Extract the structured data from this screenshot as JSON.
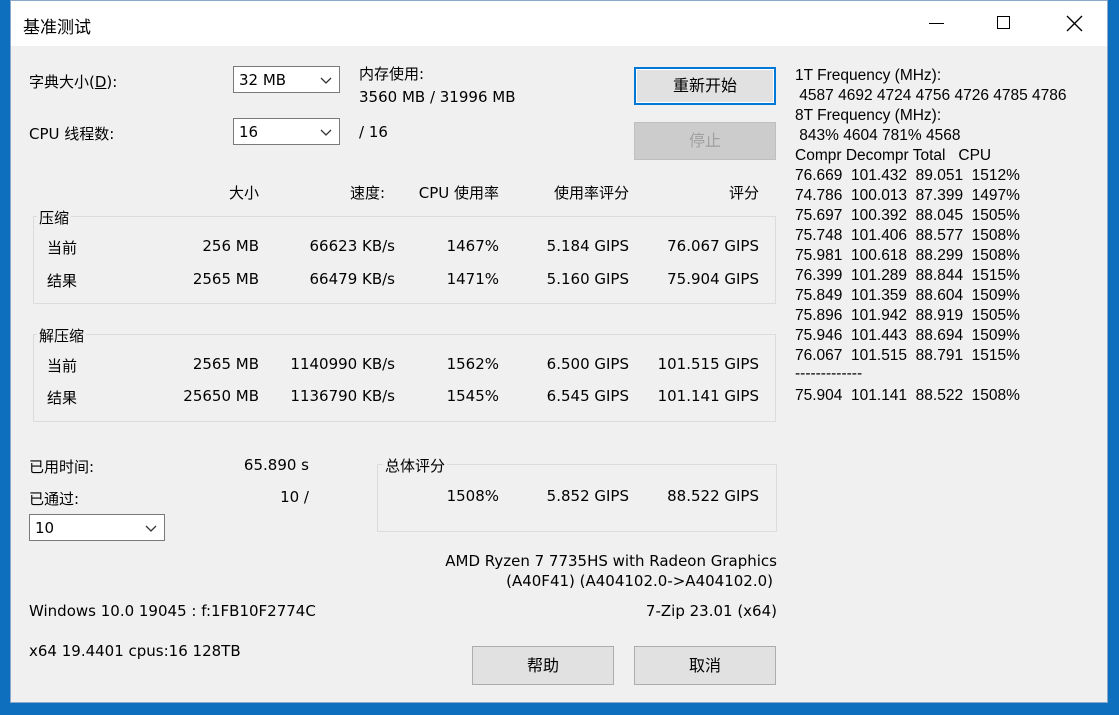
{
  "window": {
    "title": "基准测试",
    "controls": {
      "minimize": "minimize",
      "maximize": "maximize",
      "close": "close"
    }
  },
  "settings": {
    "dict_label_pre": "字典大小(",
    "dict_label_key": "D",
    "dict_label_post": "):",
    "dict_value": "32 MB",
    "threads_label": "CPU 线程数:",
    "threads_value": "16",
    "threads_total": "/ 16",
    "memory_label": "内存使用:",
    "memory_value": "3560 MB / 31996 MB"
  },
  "buttons": {
    "restart": "重新开始",
    "stop": "停止",
    "help": "帮助",
    "cancel": "取消"
  },
  "table": {
    "headers": {
      "size": "大小",
      "speed": "速度:",
      "cpu": "CPU 使用率",
      "rating_usage": "使用率评分",
      "rating": "评分"
    },
    "compress": {
      "label": "压缩",
      "rows": [
        {
          "name": "当前",
          "size": "256 MB",
          "speed": "66623 KB/s",
          "cpu": "1467%",
          "rating_usage": "5.184 GIPS",
          "rating": "76.067 GIPS"
        },
        {
          "name": "结果",
          "size": "2565 MB",
          "speed": "66479 KB/s",
          "cpu": "1471%",
          "rating_usage": "5.160 GIPS",
          "rating": "75.904 GIPS"
        }
      ]
    },
    "decompress": {
      "label": "解压缩",
      "rows": [
        {
          "name": "当前",
          "size": "2565 MB",
          "speed": "1140990 KB/s",
          "cpu": "1562%",
          "rating_usage": "6.500 GIPS",
          "rating": "101.515 GIPS"
        },
        {
          "name": "结果",
          "size": "25650 MB",
          "speed": "1136790 KB/s",
          "cpu": "1545%",
          "rating_usage": "6.545 GIPS",
          "rating": "101.141 GIPS"
        }
      ]
    }
  },
  "stats": {
    "elapsed_label": "已用时间:",
    "elapsed_value": "65.890 s",
    "passes_label": "已通过:",
    "passes_value": "10 /",
    "passes_select": "10"
  },
  "total": {
    "label": "总体评分",
    "cpu": "1508%",
    "rating_usage": "5.852 GIPS",
    "rating": "88.522 GIPS"
  },
  "system": {
    "cpu_name": "AMD Ryzen 7 7735HS with Radeon Graphics",
    "cpu_id": "(A40F41) (A404102.0->A404102.0)",
    "os": "Windows 10.0 19045 : f:1FB10F2774C",
    "version": "7-Zip 23.01 (x64)",
    "arch": "x64 19.4401 cpus:16 128TB"
  },
  "log": {
    "freq1_label": "1T Frequency (MHz):",
    "freq1_values": " 4587 4692 4724 4756 4726 4785 4786",
    "freq8_label": "8T Frequency (MHz):",
    "freq8_values": " 843% 4604 781% 4568",
    "header": "Compr Decompr Total   CPU",
    "rows": [
      "76.669  101.432  89.051  1512%",
      "74.786  100.013  87.399  1497%",
      "75.697  100.392  88.045  1505%",
      "75.748  101.406  88.577  1508%",
      "75.981  100.618  88.299  1508%",
      "76.399  101.289  88.844  1515%",
      "75.849  101.359  88.604  1509%",
      "75.896  101.942  88.919  1505%",
      "75.946  101.443  88.694  1509%",
      "76.067  101.515  88.791  1515%"
    ],
    "separator": "-------------",
    "total_row": "75.904  101.141  88.522  1508%"
  }
}
